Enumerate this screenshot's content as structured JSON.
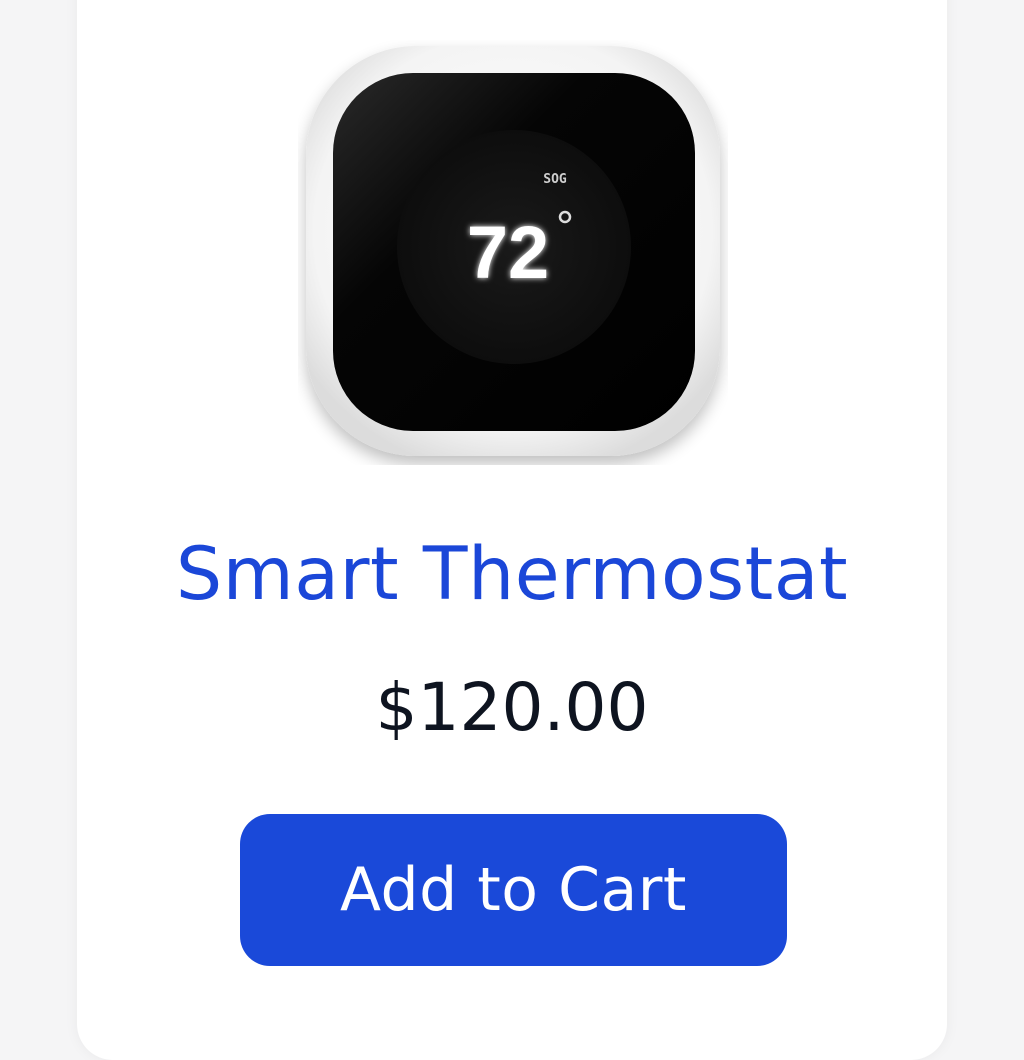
{
  "product": {
    "name": "Smart Thermostat",
    "price": "$120.00",
    "add_to_cart_label": "Add to Cart",
    "image": {
      "icon": "thermostat-image",
      "display_temperature": "72",
      "display_mode": "SOG"
    }
  },
  "colors": {
    "title": "#1b47d8",
    "button": "#1a49d9",
    "price": "#0e1420"
  }
}
